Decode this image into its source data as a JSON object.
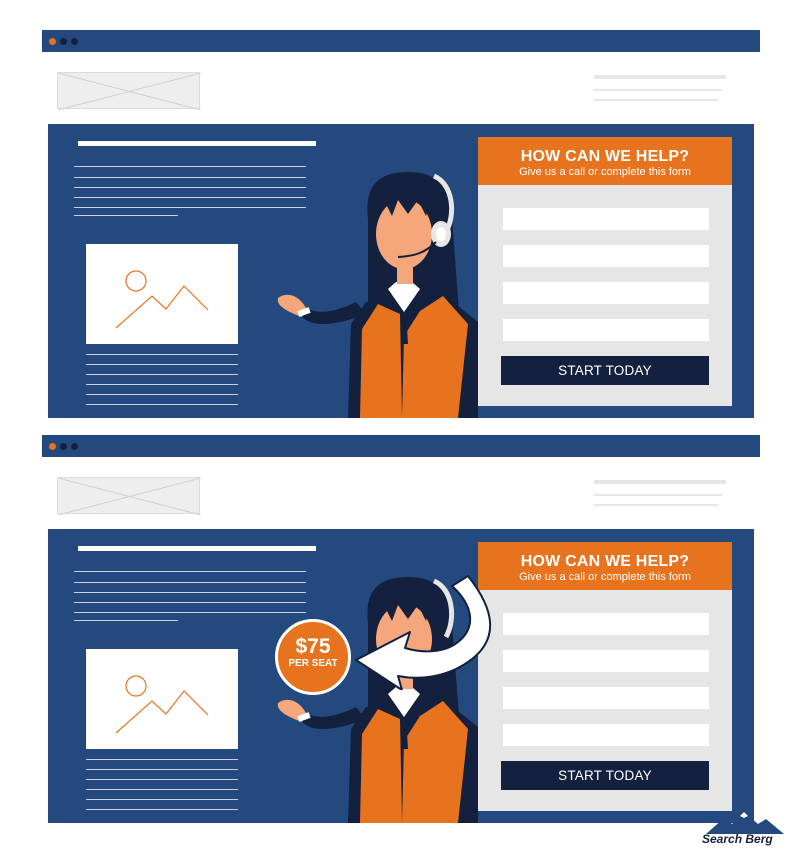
{
  "colors": {
    "navy": "#23497f",
    "dark_navy": "#13203e",
    "orange": "#e8731f",
    "light_gray": "#e6e6e6",
    "white": "#ffffff"
  },
  "panels": [
    {
      "form": {
        "title": "HOW CAN WE HELP?",
        "subtitle": "Give us a call or complete this form",
        "button": "START TODAY",
        "field_count": 4
      }
    },
    {
      "form": {
        "title": "HOW CAN WE HELP?",
        "subtitle": "Give us a call or complete this form",
        "button": "START TODAY",
        "field_count": 4
      },
      "badge": {
        "amount": "$75",
        "label": "PER SEAT"
      },
      "arrow_icon": "curved-arrow-icon"
    }
  ],
  "brand": {
    "name": "Search Berg",
    "icon": "mountain-logo-icon"
  }
}
